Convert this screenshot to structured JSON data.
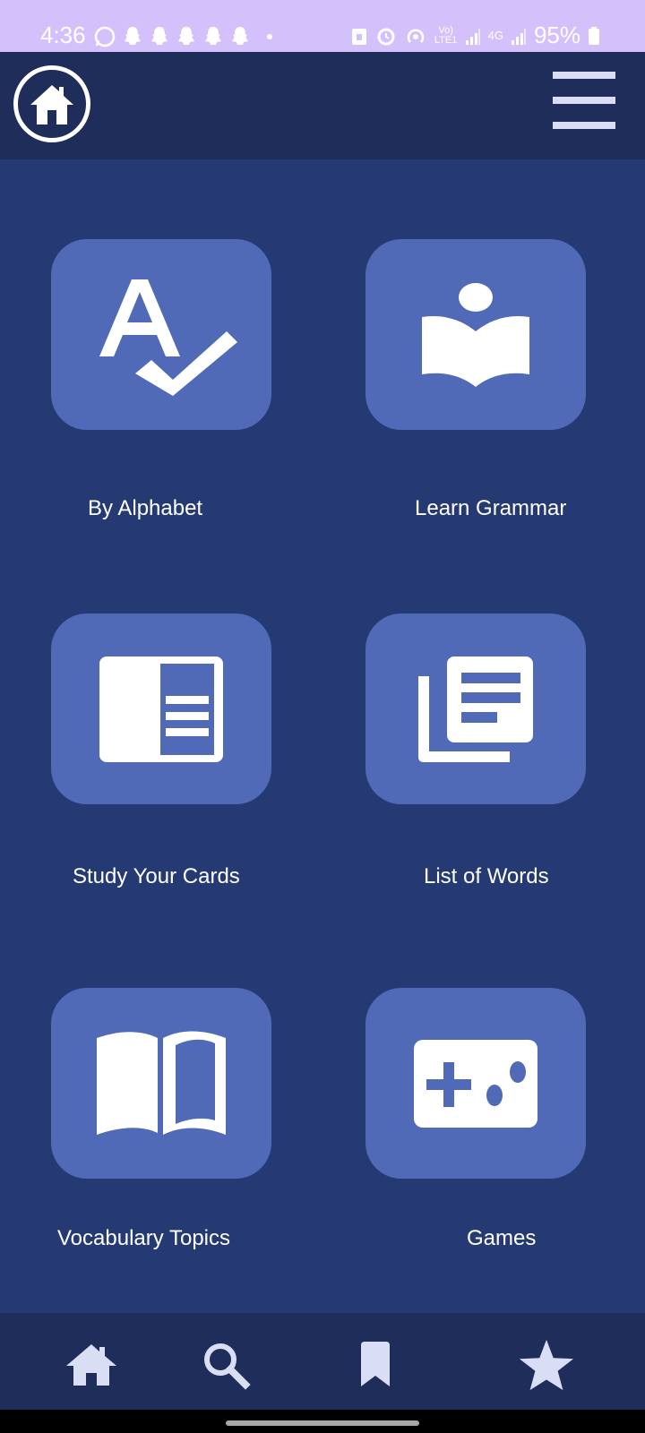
{
  "status_bar": {
    "time": "4:36",
    "battery": "95%",
    "network": "4G",
    "volte": "Vo) LTE1"
  },
  "app_bar": {
    "home_icon": "home-icon",
    "menu_icon": "hamburger-menu-icon"
  },
  "tiles": [
    {
      "label": "By Alphabet",
      "icon": "alphabet-check-icon"
    },
    {
      "label": "Learn Grammar",
      "icon": "reading-person-icon"
    },
    {
      "label": "Study Your Cards",
      "icon": "flashcard-icon"
    },
    {
      "label": "List of Words",
      "icon": "library-list-icon"
    },
    {
      "label": "Vocabulary Topics",
      "icon": "open-book-icon"
    },
    {
      "label": "Games",
      "icon": "gamepad-icon"
    }
  ],
  "bottom_nav": [
    {
      "icon": "home-icon"
    },
    {
      "icon": "search-icon"
    },
    {
      "icon": "bookmark-icon"
    },
    {
      "icon": "star-icon"
    }
  ],
  "colors": {
    "status_bar": "#d4c1fb",
    "app_bar": "#1f2d5b",
    "background": "#253a73",
    "tile": "#506ab8",
    "icon": "#ffffff"
  }
}
